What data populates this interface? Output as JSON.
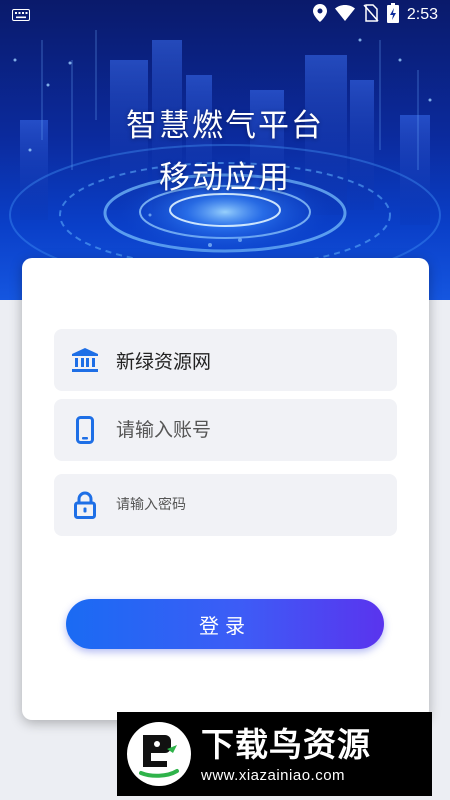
{
  "status_bar": {
    "time": "2:53",
    "icons": [
      "keyboard-icon",
      "location-icon",
      "wifi-icon",
      "no-sim-icon",
      "battery-charging-icon"
    ]
  },
  "header": {
    "title_line1": "智慧燃气平台",
    "title_line2": "移动应用"
  },
  "form": {
    "organization": {
      "value": "新绿资源网",
      "icon": "bank-icon"
    },
    "account": {
      "placeholder": "请输入账号",
      "icon": "phone-icon"
    },
    "password": {
      "placeholder": "请输入密码",
      "icon": "lock-icon"
    },
    "login_label": "登录"
  },
  "watermark": {
    "brand": "下载鸟资源",
    "url": "www.xiazainiao.com"
  },
  "colors": {
    "accent": "#1a6bf3",
    "accent_end": "#5a34ee",
    "field_bg": "#f1f2f6",
    "icon_blue": "#1e6fe6"
  }
}
